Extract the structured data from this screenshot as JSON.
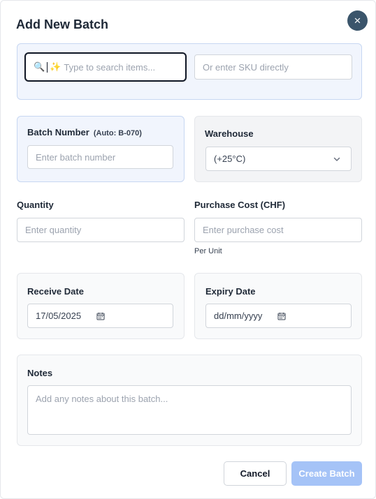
{
  "dialog": {
    "title": "Add New Batch",
    "close_icon": "×"
  },
  "search": {
    "placeholder": "Type to search items...",
    "search_icon": "🔍",
    "sparkle_icon": "✨",
    "sku_placeholder": "Or enter SKU directly"
  },
  "batch_number": {
    "label": "Batch Number",
    "auto_hint": "(Auto: B-070)",
    "placeholder": "Enter batch number"
  },
  "warehouse": {
    "label": "Warehouse",
    "selected": "(+25°C)"
  },
  "quantity": {
    "label": "Quantity",
    "placeholder": "Enter quantity"
  },
  "purchase_cost": {
    "label": "Purchase Cost (CHF)",
    "placeholder": "Enter purchase cost",
    "hint": "Per Unit"
  },
  "receive_date": {
    "label": "Receive Date",
    "value": "17/05/2025"
  },
  "expiry_date": {
    "label": "Expiry Date",
    "value": "dd/mm/yyyy"
  },
  "notes": {
    "label": "Notes",
    "placeholder": "Add any notes about this batch..."
  },
  "actions": {
    "cancel": "Cancel",
    "create": "Create Batch"
  },
  "colors": {
    "close_button": "#3b556b",
    "create_button": "#a5c3f7",
    "blue_panel": "#f1f5fd"
  }
}
